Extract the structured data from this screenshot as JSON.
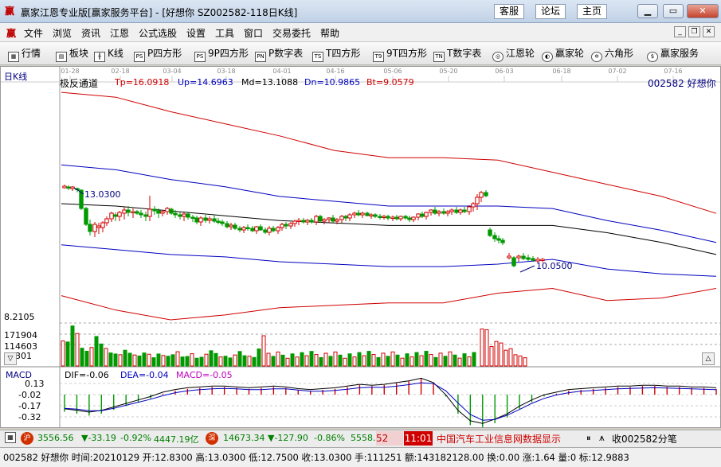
{
  "window": {
    "title": "赢家江恩专业版[赢家服务平台] - [好想你  SZ002582-118日K线]",
    "links": [
      "客服",
      "论坛",
      "主页"
    ]
  },
  "menu": [
    "文件",
    "浏览",
    "资讯",
    "江恩",
    "公式选股",
    "设置",
    "工具",
    "窗口",
    "交易委托",
    "帮助"
  ],
  "toolbar": [
    {
      "icon": "grid-icon",
      "glyph": "▦",
      "label": "行情"
    },
    {
      "icon": "blocks-icon",
      "glyph": "▤",
      "label": "板块"
    },
    {
      "icon": "candlestick-icon",
      "glyph": "╫",
      "label": "K线"
    },
    {
      "icon": "p-square-icon",
      "glyph": "PS",
      "label": "P四方形"
    },
    {
      "icon": "9p-square-icon",
      "glyph": "PS",
      "label": "9P四方形"
    },
    {
      "icon": "p-number-table-icon",
      "glyph": "PN",
      "label": "P数字表"
    },
    {
      "icon": "t-square-icon",
      "glyph": "TS",
      "label": "T四方形"
    },
    {
      "icon": "9t-square-icon",
      "glyph": "T9",
      "label": "9T四方形"
    },
    {
      "icon": "t-number-table-icon",
      "glyph": "TN",
      "label": "T数字表"
    },
    {
      "icon": "gann-wheel-icon",
      "glyph": "◎",
      "label": "江恩轮"
    },
    {
      "icon": "winner-wheel-icon",
      "glyph": "◐",
      "label": "赢家轮"
    },
    {
      "icon": "hexagon-icon",
      "glyph": "✡",
      "label": "六角形"
    },
    {
      "icon": "dollar-icon",
      "glyph": "$",
      "label": "赢家服务"
    }
  ],
  "chart": {
    "period_label": "日K线",
    "indicator_name": "极反通道",
    "params": {
      "tp": "Tp=16.0918",
      "up": "Up=14.6963",
      "md": "Md=13.1088",
      "dn": "Dn=10.9865",
      "bt": "Bt=9.0579"
    },
    "stock_label": "002582  好想你",
    "high_marker": "13.0300",
    "low_marker": "10.0500",
    "date_ticks": [
      "01-28",
      "02-18",
      "03-04",
      "03-18",
      "04-01",
      "04-16",
      "05-06",
      "05-20",
      "06-03",
      "06-18",
      "07-02",
      "07-16"
    ],
    "volume_labels": [
      "8.2105",
      "171904",
      "114603",
      "57301"
    ],
    "macd_title": "MACD",
    "macd_params": {
      "dif": "DIF=-0.06",
      "dea": "DEA=-0.04",
      "macd": "MACD=-0.05"
    },
    "macd_labels": [
      "0.13",
      "-0.02",
      "-0.17",
      "-0.32"
    ],
    "colors": {
      "up": "#d00000",
      "down": "#009900",
      "channel_outer": "#d00000",
      "channel_inner": "#0000c0",
      "mid": "#000000"
    }
  },
  "chart_data": [
    {
      "type": "line",
      "title": "极反通道",
      "series": [
        {
          "name": "Tp",
          "values": [
            17.6,
            17.4,
            16.8,
            16.3,
            15.8,
            15.2,
            14.9,
            14.9,
            14.8,
            14.3,
            13.8,
            13.3,
            12.6
          ]
        },
        {
          "name": "Up",
          "values": [
            14.6,
            14.4,
            14.0,
            13.7,
            13.3,
            13.1,
            12.9,
            12.9,
            12.9,
            12.8,
            12.3,
            11.9,
            11.4
          ]
        },
        {
          "name": "Md",
          "values": [
            13.0,
            12.9,
            12.7,
            12.5,
            12.3,
            12.2,
            12.1,
            12.1,
            12.1,
            12.1,
            11.8,
            11.4,
            10.9
          ]
        },
        {
          "name": "Dn",
          "values": [
            11.3,
            11.1,
            10.9,
            10.8,
            10.6,
            10.5,
            10.4,
            10.4,
            10.5,
            10.7,
            10.3,
            10.1,
            10.0
          ]
        },
        {
          "name": "Bt",
          "values": [
            9.2,
            8.6,
            8.2,
            8.4,
            8.7,
            8.8,
            8.9,
            8.9,
            9.3,
            9.5,
            9.0,
            9.1,
            9.5
          ]
        }
      ],
      "ylim": [
        8.2,
        17.8
      ]
    },
    {
      "type": "bar",
      "title": "成交量",
      "values": [
        100000,
        96000,
        160000,
        130000,
        71000,
        59000,
        74000,
        118000,
        88000,
        70000,
        52000,
        48000,
        45000,
        63000,
        51000,
        44000,
        40000,
        52000,
        47000,
        33000,
        48000,
        42000,
        39000,
        45000,
        57000,
        36000,
        38000,
        49000,
        31000,
        35000,
        47000,
        61000,
        50000,
        36000,
        39000,
        32000,
        44000,
        58000,
        41000,
        39000,
        34000,
        68000,
        121000,
        148000,
        145000,
        78000,
        98000,
        92000,
        63000,
        69000,
        45000,
        40000,
        33000
      ],
      "ylim": [
        0,
        171904
      ]
    },
    {
      "type": "bar",
      "title": "MACD",
      "values": [
        -0.18,
        -0.2,
        -0.22,
        -0.2,
        -0.16,
        -0.12,
        -0.08,
        -0.04,
        0.01,
        0.04,
        0.06,
        0.07,
        0.08,
        0.08,
        0.07,
        0.06,
        0.07,
        0.08,
        0.07,
        0.05,
        0.04,
        0.05,
        0.06,
        0.08,
        0.1,
        0.09,
        0.1,
        0.12,
        0.14,
        0.17,
        0.12,
        -0.02,
        -0.2,
        -0.32,
        -0.35,
        -0.3,
        -0.24,
        -0.15,
        -0.08,
        -0.02,
        0.01,
        0.04,
        0.05,
        0.06,
        0.07,
        0.08,
        0.08,
        0.09,
        0.09,
        0.08,
        0.08,
        0.07,
        0.07,
        0.06
      ],
      "ylim": [
        -0.4,
        0.2
      ]
    }
  ],
  "statusbar": {
    "sh_index": "3556.56",
    "sh_change": "▼-33.19",
    "sh_pct": "-0.92%",
    "sh_amount": "4447.19亿",
    "sz_index": "14673.34",
    "sz_change": "▼-127.90",
    "sz_pct": "-0.86%",
    "sz_amount": "5558.0",
    "ticker_num": "52",
    "news_time": "11:01",
    "news_text": "中国汽车工业信息网数据显示",
    "receive_text": "收002582分笔",
    "quote_line": "002582 好想你 时间:20210129 开:12.8300 高:13.0300 低:12.7500 收:13.0300 手:111251 额:143182128.00 换:0.00 涨:1.64 量:0 标:12.9883"
  }
}
